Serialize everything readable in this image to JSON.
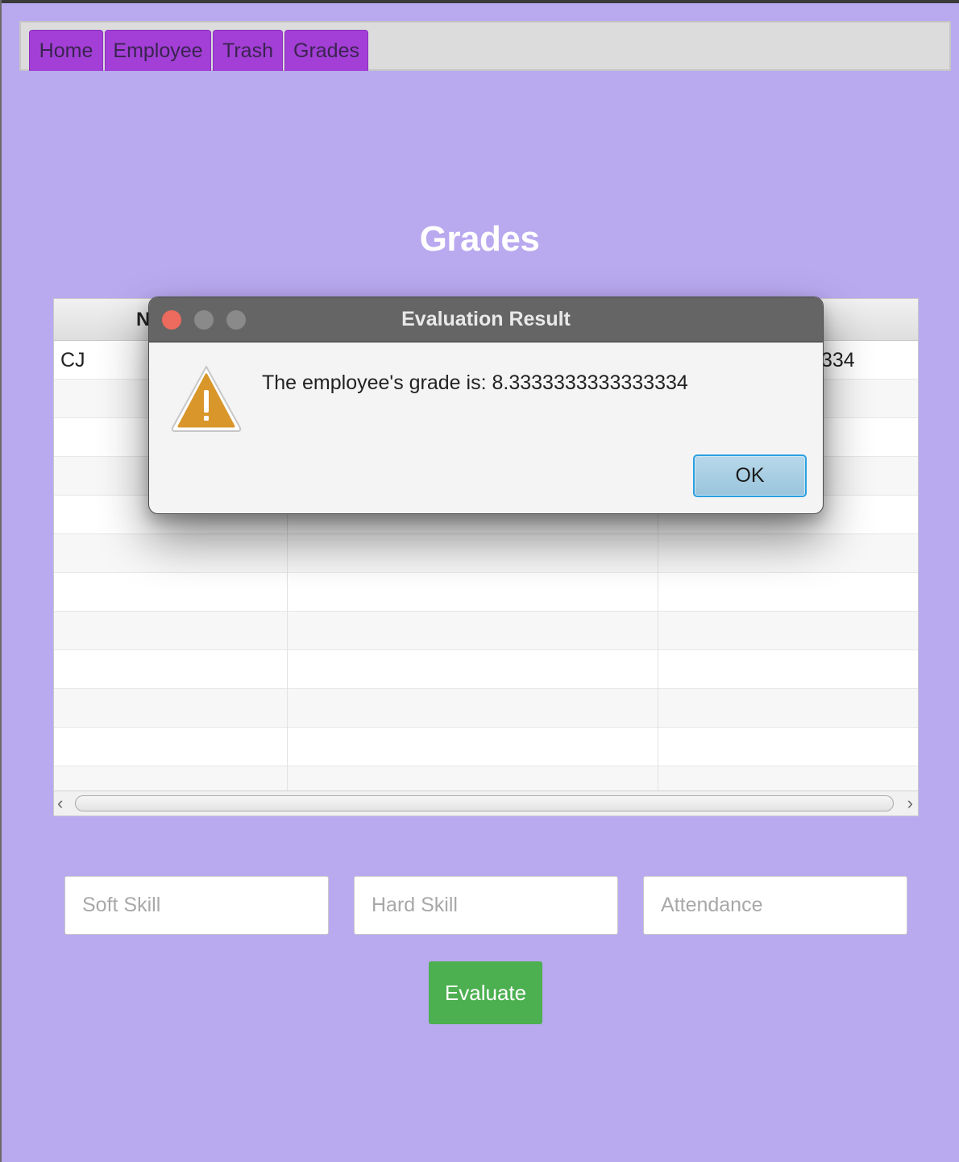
{
  "menu": {
    "items": [
      {
        "label": "Home"
      },
      {
        "label": "Employee"
      },
      {
        "label": "Trash"
      },
      {
        "label": "Grades"
      }
    ]
  },
  "page": {
    "title": "Grades"
  },
  "table": {
    "columns": [
      "N",
      "",
      ""
    ],
    "rows": [
      [
        "CJ",
        "",
        "8.3333333333333334"
      ]
    ],
    "visible_last_cell_fragment": "334"
  },
  "form": {
    "soft_skill_placeholder": "Soft Skill",
    "hard_skill_placeholder": "Hard Skill",
    "attendance_placeholder": "Attendance",
    "evaluate_label": "Evaluate"
  },
  "dialog": {
    "title": "Evaluation Result",
    "message": "The employee's grade is: 8.3333333333333334",
    "ok_label": "OK",
    "icon": "warning-icon"
  },
  "colors": {
    "background": "#b9a9ef",
    "menu_tab": "#a33fd6",
    "evaluate_button": "#4caf50",
    "warning": "#d9962b",
    "traffic_close": "#ec6a5e",
    "traffic_inactive": "#8a8a8a"
  }
}
